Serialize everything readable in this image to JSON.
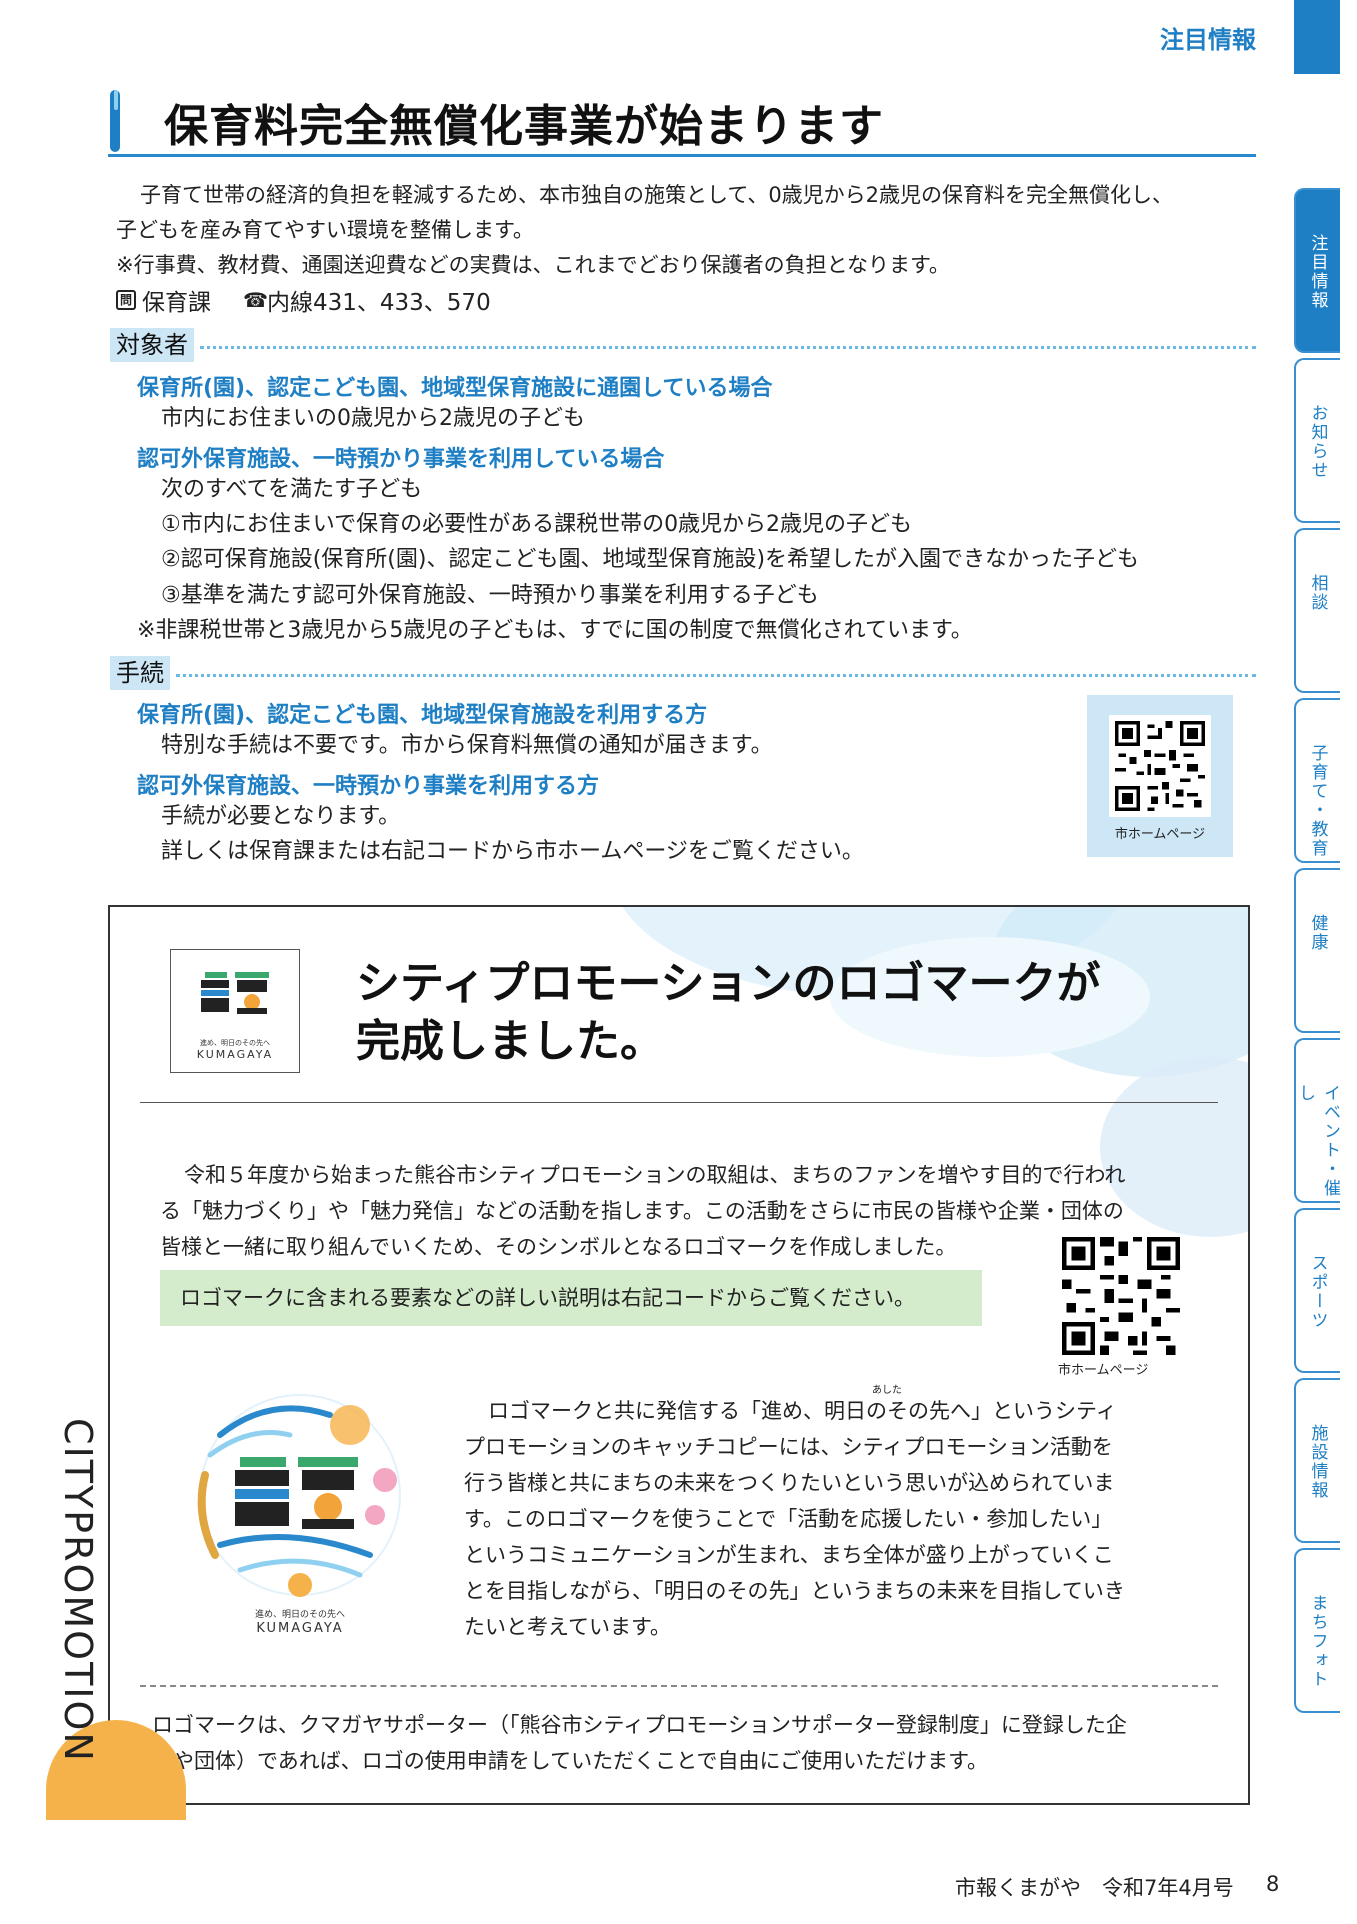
{
  "header": {
    "section": "注目情報"
  },
  "side_index": [
    {
      "label": "注目情報",
      "active": true
    },
    {
      "label": "お知らせ",
      "active": false
    },
    {
      "label": "相談",
      "active": false
    },
    {
      "label": "子育て・教育",
      "active": false
    },
    {
      "label": "健康",
      "active": false
    },
    {
      "label": "イベント・催し",
      "active": false
    },
    {
      "label": "スポーツ",
      "active": false
    },
    {
      "label": "施設情報",
      "active": false
    },
    {
      "label": "まちフォト",
      "active": false
    }
  ],
  "article": {
    "title": "保育料完全無償化事業が始まります",
    "intro_1": "子育て世帯の経済的負担を軽減するため、本市独自の施策として、0歳児から2歳児の保育料を完全無償化し、",
    "intro_2": "子どもを産み育てやすい環境を整備します。",
    "intro_note": "※行事費、教材費、通園送迎費などの実費は、これまでどおり保護者の負担となります。",
    "contact_icon": "問",
    "contact_dept": "保育課",
    "contact_phone": "内線431、433、570",
    "target": {
      "heading": "対象者",
      "case1_head": "保育所(園)、認定こども園、地域型保育施設に通園している場合",
      "case1_text": "市内にお住まいの0歳児から2歳児の子ども",
      "case2_head": "認可外保育施設、一時預かり事業を利用している場合",
      "case2_text": "次のすべてを満たす子ども",
      "case2_item1": "①市内にお住まいで保育の必要性がある課税世帯の0歳児から2歳児の子ども",
      "case2_item2": "②認可保育施設(保育所(園)、認定こども園、地域型保育施設)を希望したが入園できなかった子ども",
      "case2_item3": "③基準を満たす認可外保育施設、一時預かり事業を利用する子ども",
      "note": "※非課税世帯と3歳児から5歳児の子どもは、すでに国の制度で無償化されています。"
    },
    "procedure": {
      "heading": "手続",
      "case1_head": "保育所(園)、認定こども園、地域型保育施設を利用する方",
      "case1_text": "特別な手続は不要です。市から保育料無償の通知が届きます。",
      "case2_head": "認可外保育施設、一時預かり事業を利用する方",
      "case2_text1": "手続が必要となります。",
      "case2_text2": "詳しくは保育課または右記コードから市ホームページをご覧ください。"
    },
    "qr_caption": "市ホームページ"
  },
  "promo": {
    "logo_tagline": "進め、明日のその先へ",
    "logo_brand": "KUMAGAYA",
    "title_line1": "シティプロモーションのロゴマークが",
    "title_line2": "完成しました。",
    "p1_line1": "令和５年度から始まった熊谷市シティプロモーションの取組は、まちのファンを増やす目的で行われ",
    "p1_line2": "る「魅力づくり」や「魅力発信」などの活動を指します。この活動をさらに市民の皆様や企業・団体の",
    "p1_line3": "皆様と一緒に取り組んでいくため、そのシンボルとなるロゴマークを作成しました。",
    "green_note": "ロゴマークに含まれる要素などの詳しい説明は右記コードからご覧ください。",
    "qr_caption": "市ホームページ",
    "ruby": "あした",
    "p2_line1": "ロゴマークと共に発信する「進め、明日のその先へ」というシティ",
    "p2_line2": "プロモーションのキャッチコピーには、シティプロモーション活動を",
    "p2_line3": "行う皆様と共にまちの未来をつくりたいという思いが込められていま",
    "p2_line4": "す。このロゴマークを使うことで「活動を応援したい・参加したい」",
    "p2_line5": "というコミュニケーションが生まれ、まち全体が盛り上がっていくこ",
    "p2_line6": "とを目指しながら、「明日のその先」というまちの未来を目指していき",
    "p2_line7": "たいと考えています。",
    "p3_line1": "ロゴマークは、クマガヤサポーター（「熊谷市シティプロモーションサポーター登録制度」に登録した企",
    "p3_line2": "業や団体）であれば、ロゴの使用申請をしていただくことで自由にご使用いただけます。",
    "vertical_label": "CITYPROMOTION"
  },
  "footer": {
    "publication": "市報くまがや　令和7年4月号",
    "page": "8"
  },
  "colors": {
    "accent": "#1f7fc4",
    "light_blue": "#cce6f6",
    "green": "#d5eccc",
    "orange": "#f6b24a"
  }
}
